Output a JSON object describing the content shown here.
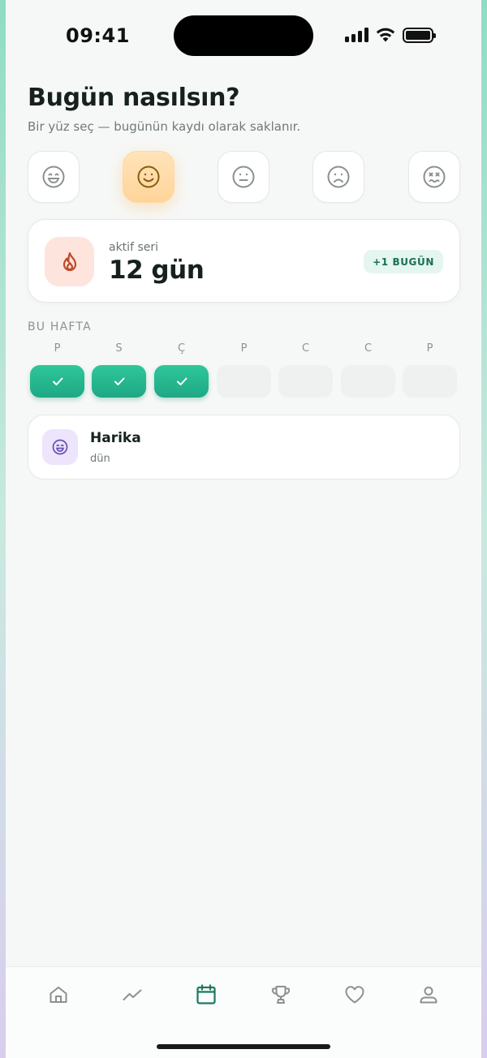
{
  "status_bar": {
    "time": "09:41"
  },
  "header": {
    "title": "Bugün nasılsın?",
    "subtitle": "Bir yüz seç — bugünün kaydı olarak saklanır."
  },
  "moods": [
    {
      "icon": "grin-face-icon",
      "selected": false
    },
    {
      "icon": "smile-face-icon",
      "selected": true
    },
    {
      "icon": "neutral-face-icon",
      "selected": false
    },
    {
      "icon": "sad-face-icon",
      "selected": false
    },
    {
      "icon": "angry-face-icon",
      "selected": false
    }
  ],
  "streak": {
    "label": "aktif seri",
    "value": "12 gün",
    "badge": "+1 BUGÜN",
    "icon": "flame-icon"
  },
  "week": {
    "label": "BU HAFTA",
    "days": [
      {
        "letter": "P",
        "done": true
      },
      {
        "letter": "S",
        "done": true
      },
      {
        "letter": "Ç",
        "done": true
      },
      {
        "letter": "P",
        "done": false
      },
      {
        "letter": "C",
        "done": false
      },
      {
        "letter": "C",
        "done": false
      },
      {
        "letter": "P",
        "done": false
      }
    ]
  },
  "entry": {
    "title": "Harika",
    "subtitle": "dün",
    "icon": "grin-face-icon"
  },
  "tabbar": {
    "active": "calendar",
    "items": [
      "home-icon",
      "trend-icon",
      "calendar-icon",
      "trophy-icon",
      "heart-icon",
      "profile-icon"
    ]
  },
  "colors": {
    "accent": "#1ea884",
    "selected_mood": "#ffd49a",
    "flame_bg": "#fde4dc",
    "flame": "#c0492a",
    "badge_bg": "#e4f6ef",
    "entry_icon_bg": "#ece5fb"
  }
}
